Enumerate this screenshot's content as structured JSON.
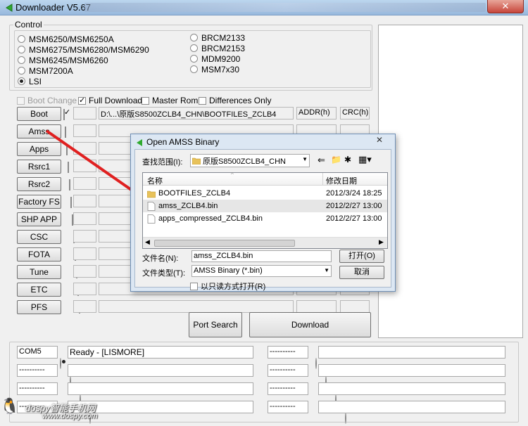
{
  "window": {
    "title": "Downloader V5.67",
    "close_label": "✕"
  },
  "control": {
    "legend": "Control",
    "models_left": [
      "MSM6250/MSM6250A",
      "MSM6275/MSM6280/MSM6290",
      "MSM6245/MSM6260",
      "MSM7200A",
      "LSI"
    ],
    "models_right": [
      "BRCM2133",
      "BRCM2153",
      "MDM9200",
      "MSM7x30"
    ],
    "selected": "LSI"
  },
  "options": {
    "boot_change": "Boot Change",
    "full_download": "Full Download",
    "master_rom": "Master Rom",
    "differences_only": "Differences Only"
  },
  "file_rows": [
    {
      "label": "Boot",
      "checked": true,
      "path": "D:\\...\\原版S8500ZCLB4_CHN\\BOOTFILES_ZCLB4",
      "addr": "ADDR(h)",
      "crc": "CRC(h)"
    },
    {
      "label": "Amss",
      "checked": false,
      "path": "",
      "addr": "",
      "crc": ""
    },
    {
      "label": "Apps",
      "checked": false,
      "path": "",
      "addr": "",
      "crc": ""
    },
    {
      "label": "Rsrc1",
      "checked": false,
      "path": "",
      "addr": "",
      "crc": ""
    },
    {
      "label": "Rsrc2",
      "checked": false,
      "path": "",
      "addr": "",
      "crc": ""
    },
    {
      "label": "Factory FS",
      "checked": false,
      "path": "",
      "addr": "",
      "crc": ""
    },
    {
      "label": "SHP APP",
      "checked": false,
      "path": "",
      "addr": "",
      "crc": ""
    },
    {
      "label": "CSC",
      "checked": false,
      "path": "",
      "addr": "",
      "crc": ""
    },
    {
      "label": "FOTA",
      "checked": false,
      "path": "",
      "addr": "",
      "crc": ""
    },
    {
      "label": "Tune",
      "checked": false,
      "path": "",
      "addr": "",
      "crc": ""
    },
    {
      "label": "ETC",
      "checked": false,
      "path": "",
      "addr": "",
      "crc": ""
    },
    {
      "label": "PFS",
      "checked": false,
      "path": "",
      "addr": "",
      "crc": ""
    }
  ],
  "actions": {
    "port_search": "Port Search",
    "download": "Download"
  },
  "ports": [
    {
      "name": "COM5",
      "status": "Ready - [LISMORE]",
      "selected": true
    },
    {
      "name": "----------",
      "status": "",
      "selected": false
    },
    {
      "name": "----------",
      "status": "",
      "selected": false
    },
    {
      "name": "----------",
      "status": "",
      "selected": false
    }
  ],
  "ports_right": [
    "----------",
    "----------",
    "----------",
    "----------"
  ],
  "dialog": {
    "title": "Open AMSS Binary",
    "close_label": "✕",
    "look_in_label": "查找范围(I):",
    "look_in_value": "原版S8500ZCLB4_CHN",
    "col_name": "名称",
    "col_date": "修改日期",
    "files": [
      {
        "name": "BOOTFILES_ZCLB4",
        "date": "2012/3/24 18:25",
        "type": "folder"
      },
      {
        "name": "amss_ZCLB4.bin",
        "date": "2012/2/27 13:00",
        "type": "file"
      },
      {
        "name": "apps_compressed_ZCLB4.bin",
        "date": "2012/2/27 13:00",
        "type": "file"
      }
    ],
    "filename_label": "文件名(N):",
    "filename_value": "amss_ZCLB4.bin",
    "filetype_label": "文件类型(T):",
    "filetype_value": "AMSS Binary (*.bin)",
    "open_label": "打开(O)",
    "cancel_label": "取消",
    "readonly_label": "以只读方式打开(R)"
  },
  "watermark": {
    "text": "dospy智能手机网",
    "url": "www.dospy.com"
  },
  "colors": {
    "arrow": "#e02020",
    "title_bar": "#a9c6e6",
    "dialog_frame": "#dce7f3"
  }
}
